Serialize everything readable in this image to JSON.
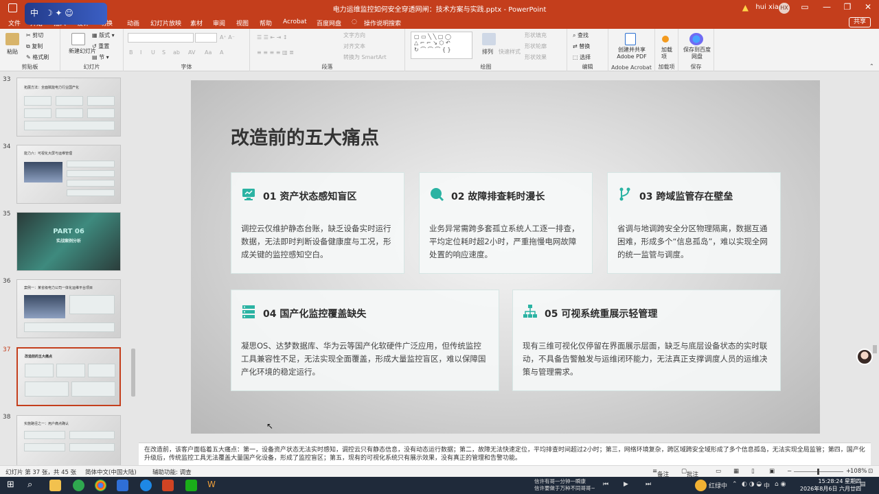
{
  "window": {
    "title": "电力运维监控如何安全穿透网闸：技术方案与实践.pptx  -  PowerPoint",
    "user": "hui xiao",
    "user_initials": "HX"
  },
  "ime": {
    "label": "中"
  },
  "menu": {
    "tabs": [
      "文件",
      "开始",
      "插入",
      "设计",
      "切换",
      "动画",
      "幻灯片放映",
      "素材",
      "审阅",
      "视图",
      "帮助",
      "Acrobat",
      "百度网盘",
      "操作说明搜索"
    ],
    "share": "共享"
  },
  "ribbon": {
    "clipboard": {
      "paste": "粘贴",
      "cut": "剪切",
      "copy": "复制",
      "format_painter": "格式刷",
      "label": "剪贴板"
    },
    "slides": {
      "new_slide": "新建幻灯片",
      "layout": "版式",
      "reset": "重置",
      "section": "节",
      "label": "幻灯片"
    },
    "font": {
      "label": "字体",
      "buttons": [
        "B",
        "I",
        "U",
        "S",
        "ab",
        "AV",
        "Aa",
        "A"
      ]
    },
    "paragraph": {
      "text_direction": "文字方向",
      "align_text": "对齐文本",
      "smartart": "转换为 SmartArt",
      "label": "段落"
    },
    "drawing": {
      "arrange": "排列",
      "quick_styles": "快速样式",
      "fill": "形状填充",
      "outline": "形状轮廓",
      "effects": "形状效果",
      "label": "绘图"
    },
    "editing": {
      "find": "查找",
      "replace": "替换",
      "select": "选择",
      "label": "编辑"
    },
    "acrobat": {
      "create_pdf": "创建并共享 Adobe PDF",
      "label": "Adobe Acrobat"
    },
    "addins": {
      "btn": "加载项",
      "label": "加载项"
    },
    "save": {
      "btn": "保存到百度网盘",
      "label": "保存"
    }
  },
  "thumbnails": [
    {
      "num": "33",
      "caption": "拓展方法：全面赋能电力行业国产化"
    },
    {
      "num": "34",
      "caption": "能力六：可视化大屏与运维管理"
    },
    {
      "num": "35",
      "caption": "PART 06",
      "sub": "实战案例分析"
    },
    {
      "num": "36",
      "caption": "案例一：某省级电力公司一体化运维平台项目"
    },
    {
      "num": "37",
      "caption": "改造前的五大痛点"
    },
    {
      "num": "38",
      "caption": "实施路径之一：用户痛点确认"
    }
  ],
  "slide": {
    "title": "改造前的五大痛点",
    "cards": [
      {
        "title": "01 资产状态感知盲区",
        "body": "调控云仅维护静态台账，缺乏设备实时运行数据，无法即时判断设备健康度与工况，形成关键的监控感知空白。"
      },
      {
        "title": "02 故障排查耗时漫长",
        "body": "业务异常需跨多套孤立系统人工逐一排查，平均定位耗时超2小时，严重拖慢电网故障处置的响应速度。"
      },
      {
        "title": "03 跨域监管存在壁垒",
        "body": "省调与地调跨安全分区物理隔离，数据互通困难，形成多个“信息孤岛”，难以实现全网的统一监管与调度。"
      },
      {
        "title": "04 国产化监控覆盖缺失",
        "body": "凝思OS、达梦数据库、华为云等国产化软硬件广泛应用，但传统监控工具兼容性不足，无法实现全面覆盖，形成大量监控盲区，难以保障国产化环境的稳定运行。"
      },
      {
        "title": "05 可视系统重展示轻管理",
        "body": "现有三维可视化仅停留在界面展示层面，缺乏与底层设备状态的实时联动，不具备告警触发与运维闭环能力，无法真正支撑调度人员的运维决策与管理需求。"
      }
    ]
  },
  "notes": "在改造前，该客户面临着五大痛点：第一，设备资产状态无法实时感知，调控云只有静态信息，没有动态运行数据；第二，故障无法快速定位，平均排查时间超过2小时；第三，网络环境复杂，跨区域跨安全域形成了多个信息孤岛，无法实现全局监管；第四，国产化升级后，传统监控工具无法覆盖大量国产化设备，形成了监控盲区；第五，现有的可视化系统只有展示效果，没有真正的管理和告警功能。",
  "status": {
    "slide_pos": "幻灯片 第 37 张，共 45 张",
    "language": "简体中文(中国大陆)",
    "accessibility": "辅助功能: 调查",
    "notes_btn": "备注",
    "comments_btn": "批注",
    "zoom": "108%"
  },
  "taskbar": {
    "news_line1": "信许有哥一分钟一瞬康",
    "news_line2": "信许要做于万种不同哥哥~",
    "weather": "红绿中",
    "ime": "中",
    "time": "15:28:24 星期四",
    "date": "2026年8月6日 六月廿四"
  },
  "colors": {
    "accent": "#c43e1c",
    "teal": "#2bb3a3"
  }
}
